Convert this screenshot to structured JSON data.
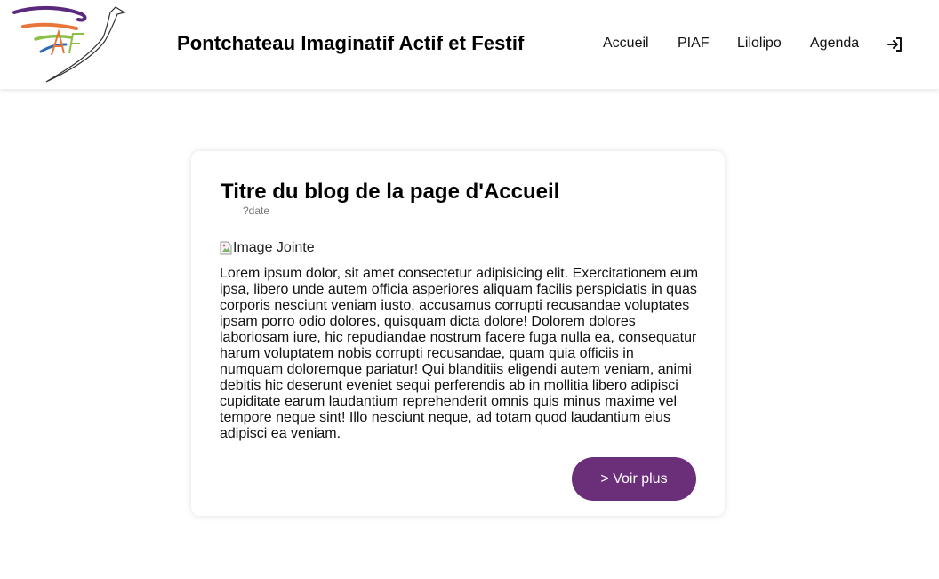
{
  "header": {
    "site_title": "Pontchateau Imaginatif Actif et Festif",
    "logo_icon": "bird-logo-icon",
    "nav": [
      {
        "label": "Accueil"
      },
      {
        "label": "PIAF"
      },
      {
        "label": "Lilolipo"
      },
      {
        "label": "Agenda"
      }
    ],
    "login_icon": "sign-in-icon"
  },
  "post": {
    "title": "Titre du blog de la page d'Accueil",
    "date": "?date",
    "image_alt": "Image Jointe",
    "body": "Lorem ipsum dolor, sit amet consectetur adipisicing elit. Exercitationem eum ipsa, libero unde autem officia asperiores aliquam facilis perspiciatis in quas corporis nesciunt veniam iusto, accusamus corrupti recusandae voluptates ipsam porro odio dolores, quisquam dicta dolore! Dolorem dolores laboriosam iure, hic repudiandae nostrum facere fuga nulla ea, consequatur harum voluptatem nobis corrupti recusandae, quam quia officiis in numquam doloremque pariatur! Qui blanditiis eligendi autem veniam, animi debitis hic deserunt eveniet sequi perferendis ab in mollitia libero adipisci cupiditate earum laudantium reprehenderit omnis quis minus maxime vel tempore neque sint! Illo nesciunt neque, ad totam quod laudantium eius adipisci ea veniam.",
    "more_label": "> Voir plus"
  },
  "colors": {
    "accent": "#6b2f7a",
    "logo_purple": "#5b2a7f",
    "logo_orange": "#e8753a",
    "logo_green": "#8cc046",
    "logo_blue": "#2e6db4"
  }
}
